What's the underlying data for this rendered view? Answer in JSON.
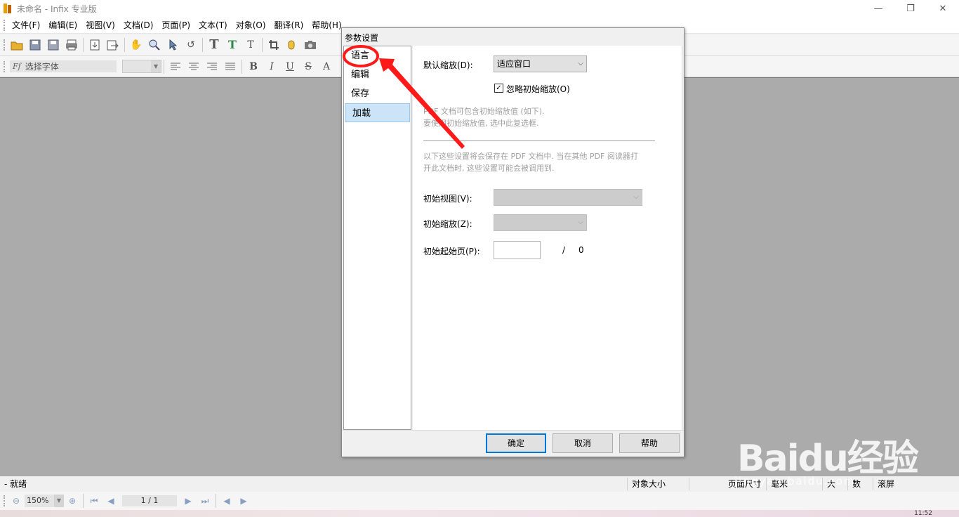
{
  "window": {
    "title": "未命名 - Infix 专业版",
    "controls": [
      "—",
      "❐",
      "✕"
    ]
  },
  "menu": [
    "文件(F)",
    "编辑(E)",
    "视图(V)",
    "文档(D)",
    "页面(P)",
    "文本(T)",
    "对象(O)",
    "翻译(R)",
    "帮助(H)"
  ],
  "toolbar2": {
    "font_placeholder": "选择字体",
    "format_buttons": [
      "B",
      "I",
      "U",
      "S",
      "A"
    ]
  },
  "dialog": {
    "title": "参数设置",
    "nav": [
      {
        "label": "语言",
        "selected": false
      },
      {
        "label": "编辑",
        "selected": false
      },
      {
        "label": "保存",
        "selected": false
      },
      {
        "label": "加载",
        "selected": true
      }
    ],
    "default_zoom_label": "默认缩放(D):",
    "default_zoom_value": "适应窗口",
    "ignore_initial_zoom_label": "忽略初始缩放(O)",
    "ignore_initial_zoom_checked": true,
    "note1_line1": "PDF 文档可包含初始缩放值 (如下).",
    "note1_line2": "要使用初始缩放值, 选中此复选框.",
    "note2_line1": "以下这些设置将会保存在 PDF 文档中. 当在其他 PDF 阅读器打",
    "note2_line2": "开此文档时, 这些设置可能会被调用到.",
    "initial_view_label": "初始视图(V):",
    "initial_zoom_label": "初始缩放(Z):",
    "initial_page_label": "初始起始页(P):",
    "page_separator": "/",
    "page_total": "0",
    "buttons": {
      "ok": "确定",
      "cancel": "取消",
      "help": "帮助"
    }
  },
  "status": {
    "ready": "就绪",
    "object_size": "对象大小",
    "page_size": "页面尺寸",
    "units": "毫米",
    "caps": "大写",
    "num": "数字",
    "scroll": "滚屏"
  },
  "nav": {
    "zoom": "150%",
    "page": "1 / 1"
  },
  "taskbar": {
    "clock": "11:52"
  },
  "watermark": {
    "logo": "Baidu经验",
    "url": "jingyan.baidu.com"
  },
  "colors": {
    "annotation": "#ff1a1a",
    "selection": "#cce4f7",
    "default_button": "#0078d7"
  }
}
